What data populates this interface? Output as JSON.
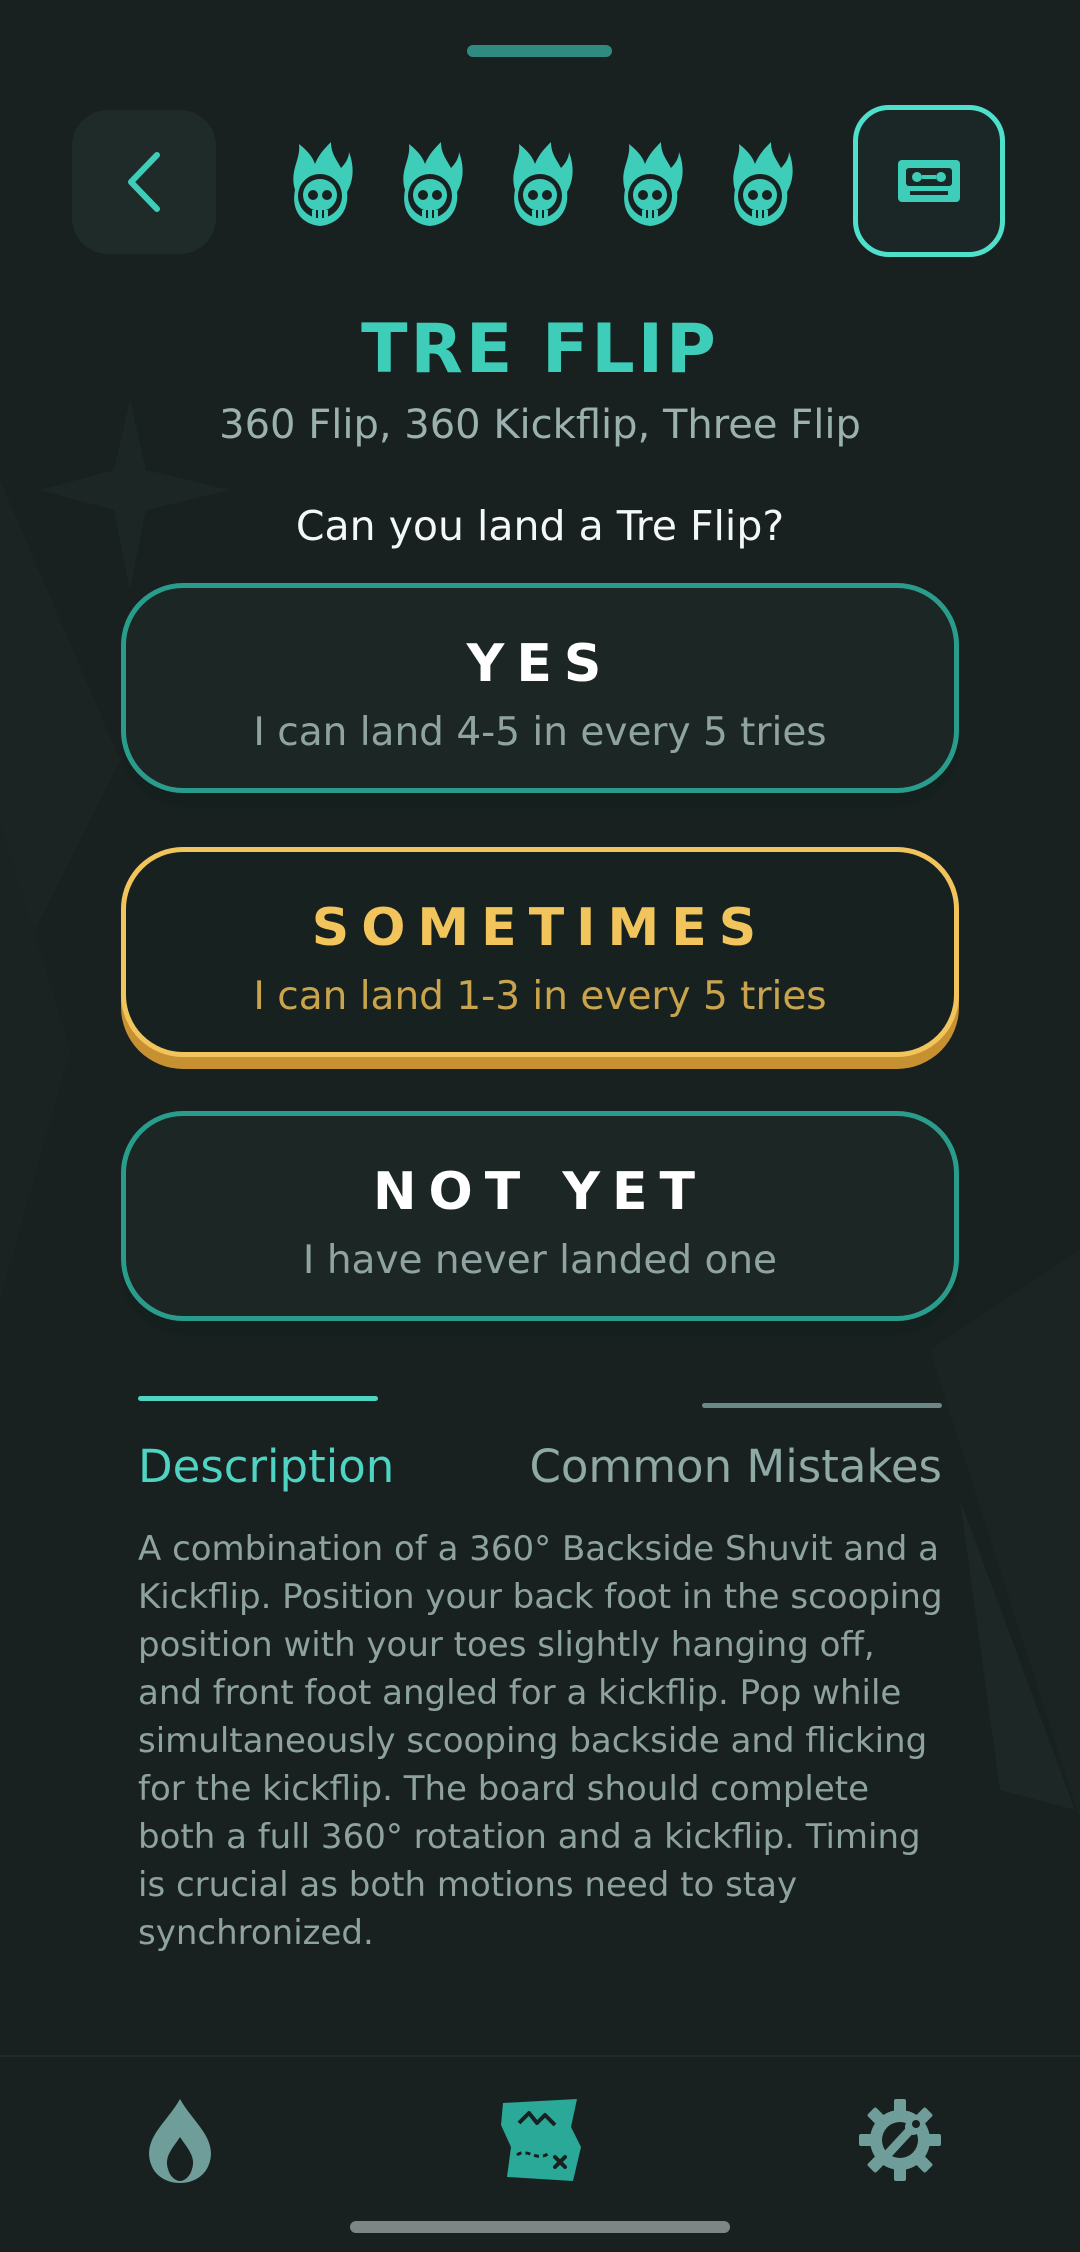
{
  "header": {
    "lives_count": 5,
    "icons": {
      "back": "chevron-left-icon",
      "life": "flaming-skull-icon",
      "video": "vhs-tape-icon"
    }
  },
  "trick": {
    "title": "TRE FLIP",
    "aliases": "360 Flip, 360 Kickflip, Three Flip",
    "question": "Can you land a Tre Flip?"
  },
  "options": [
    {
      "label": "YES",
      "sub": "I can land 4-5 in every 5 tries",
      "selected": false
    },
    {
      "label": "SOMETIMES",
      "sub": "I can land 1-3 in every 5 tries",
      "selected": true
    },
    {
      "label": "NOT YET",
      "sub": "I have never landed one",
      "selected": false
    }
  ],
  "tabs": [
    {
      "label": "Description",
      "active": true
    },
    {
      "label": "Common Mistakes",
      "active": false
    }
  ],
  "description": "A combination of a 360° Backside Shuvit and a Kickflip. Position your back foot in the scooping position with your toes slightly hanging off, and front foot angled for a kickflip. Pop while simultaneously scooping backside and flicking for the kickflip. The board should complete both a full 360° rotation and a kickflip. Timing is crucial as both motions need to stay synchronized.",
  "bottom_nav": [
    {
      "icon": "flame-icon",
      "active": false
    },
    {
      "icon": "treasure-map-icon",
      "active": true
    },
    {
      "icon": "gear-wrench-icon",
      "active": false
    }
  ],
  "colors": {
    "background": "#182120",
    "accent_teal": "#3ecdb8",
    "selected_gold": "#f2c55c",
    "muted_text": "#8ea29f"
  }
}
